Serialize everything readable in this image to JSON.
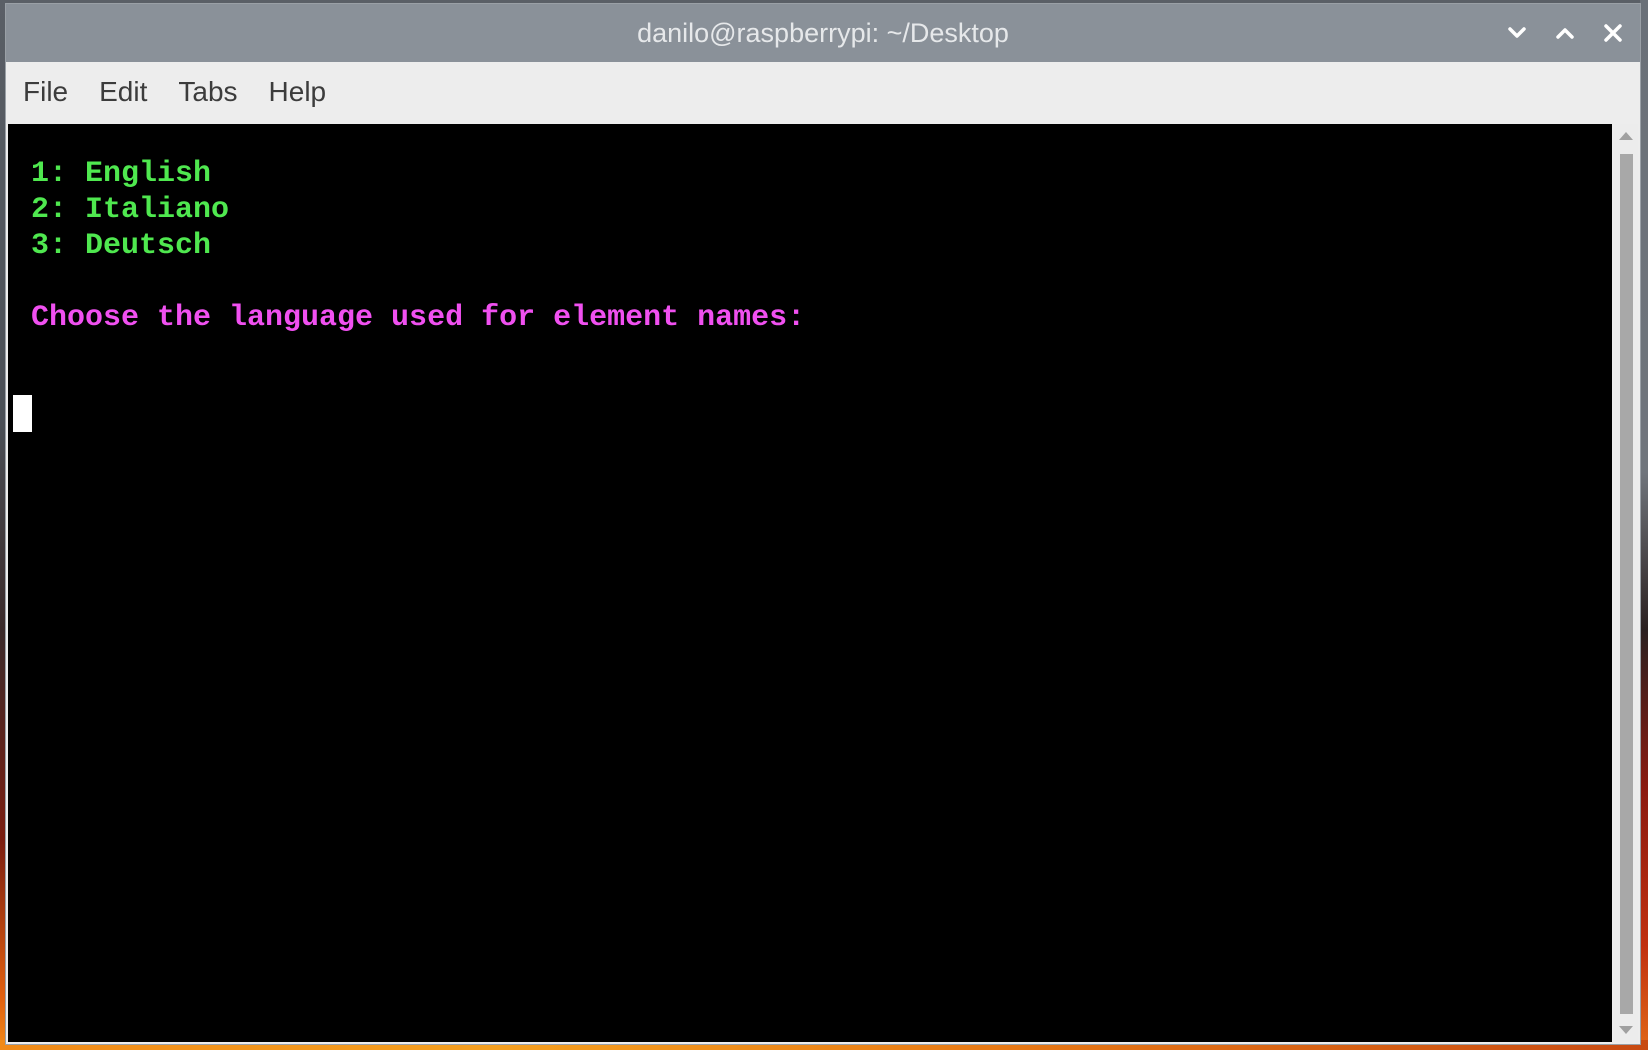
{
  "window": {
    "title": "danilo@raspberrypi: ~/Desktop",
    "controls": {
      "minimize_icon": "chevron-down-icon",
      "maximize_icon": "chevron-up-icon",
      "close_icon": "close-icon"
    }
  },
  "menubar": {
    "items": [
      {
        "label": "File"
      },
      {
        "label": "Edit"
      },
      {
        "label": "Tabs"
      },
      {
        "label": "Help"
      }
    ]
  },
  "terminal": {
    "options": [
      {
        "text": "1: English"
      },
      {
        "text": "2: Italiano"
      },
      {
        "text": "3: Deutsch"
      }
    ],
    "prompt": "Choose the language used for element names:",
    "input_value": "",
    "colors": {
      "background": "#000000",
      "option_text": "#4fe84f",
      "prompt_text": "#f050f0",
      "cursor": "#ffffff"
    }
  },
  "scrollbar": {
    "position_fraction": 0.0,
    "visible_fraction": 1.0
  }
}
